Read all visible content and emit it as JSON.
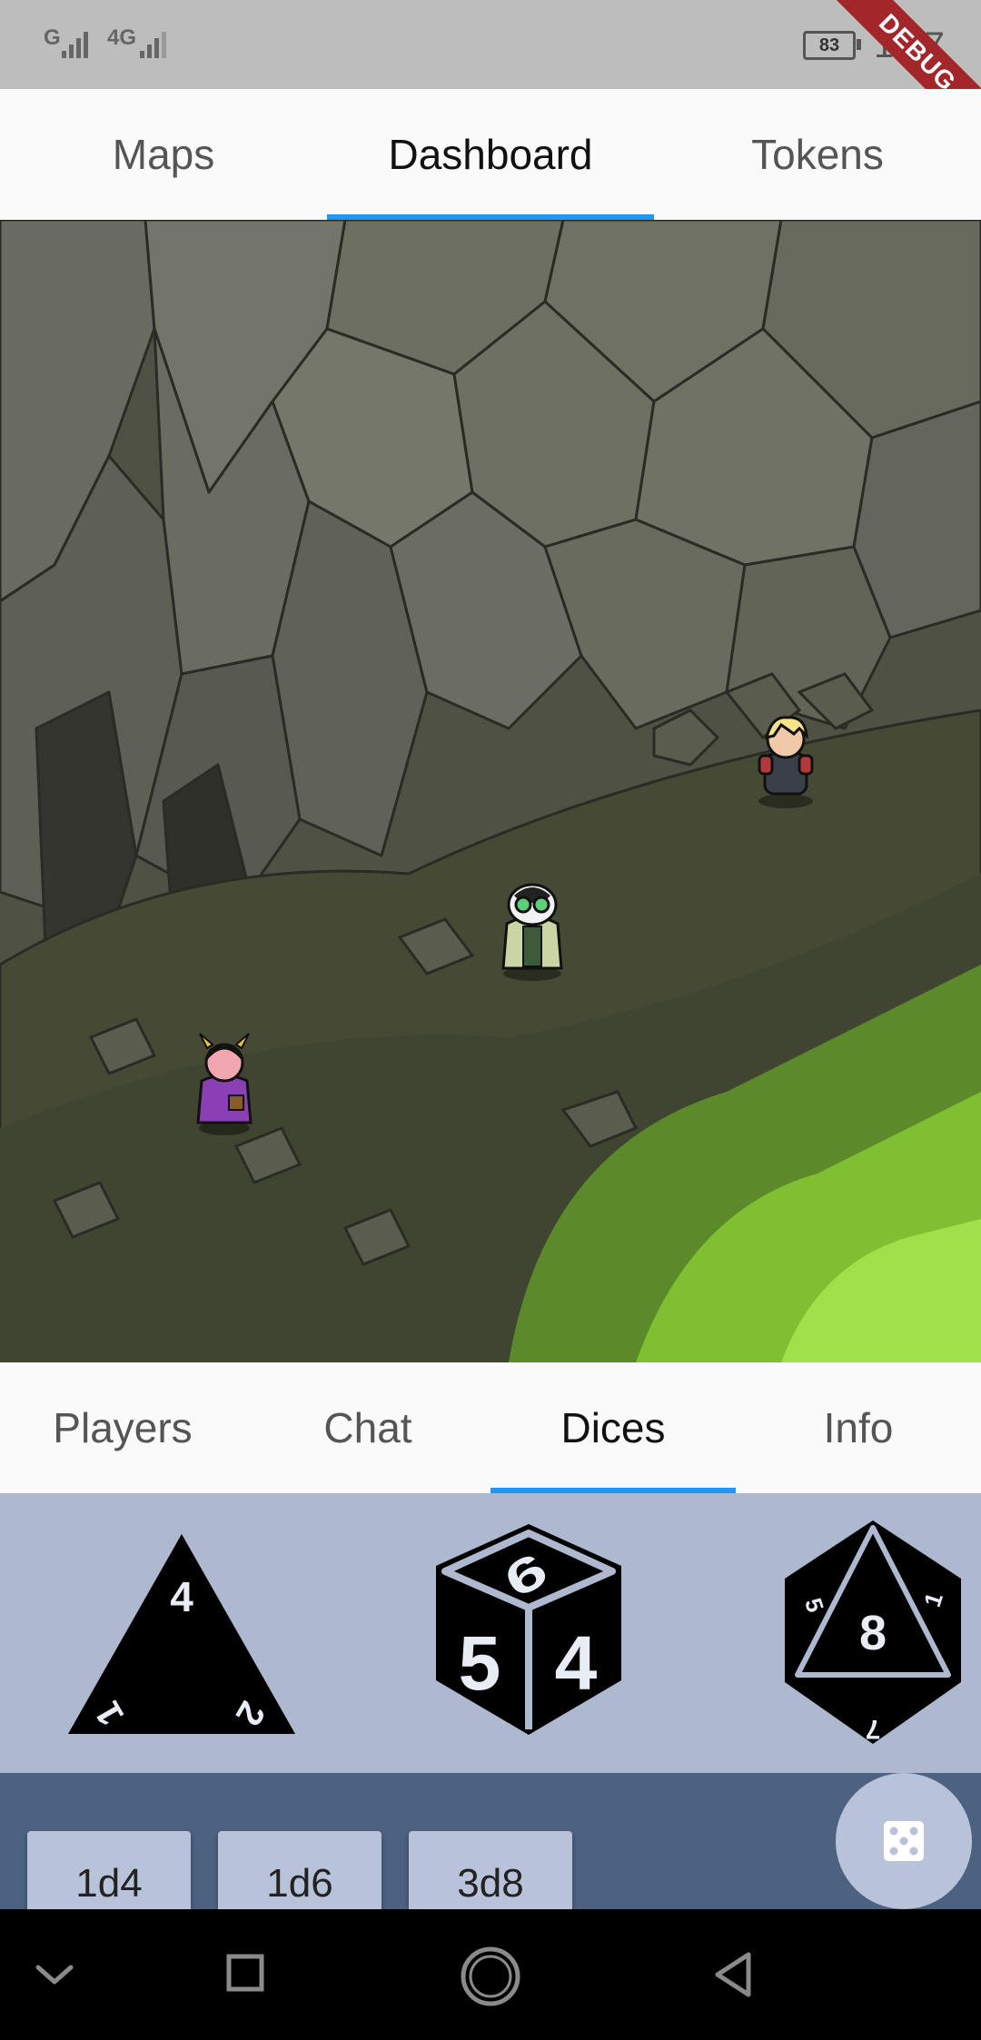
{
  "status_bar": {
    "signal_1": "G",
    "signal_2": "4G",
    "battery": "83",
    "time": "1:47",
    "debug_label": "DEBUG"
  },
  "top_tabs": [
    {
      "label": "Maps",
      "active": false
    },
    {
      "label": "Dashboard",
      "active": true
    },
    {
      "label": "Tokens",
      "active": false
    }
  ],
  "map": {
    "tokens": [
      "blonde-warrior-token",
      "badger-sage-token",
      "horned-mage-token"
    ],
    "delete_icon": "trash-icon",
    "delete_color": "#f2413a"
  },
  "sub_tabs": [
    {
      "label": "Players",
      "active": false
    },
    {
      "label": "Chat",
      "active": false
    },
    {
      "label": "Dices",
      "active": true
    },
    {
      "label": "Info",
      "active": false
    }
  ],
  "dice": {
    "d4": {
      "top": "4",
      "left": "1",
      "right": "2"
    },
    "d6": {
      "top": "6",
      "left": "5",
      "right": "4"
    },
    "d8": {
      "center": "8",
      "left": "5",
      "right": "1",
      "bottom": "7"
    }
  },
  "rolls": [
    "1d4",
    "1d6",
    "3d8"
  ],
  "roll_button_icon": "dice-icon",
  "accent_color": "#2196f3"
}
